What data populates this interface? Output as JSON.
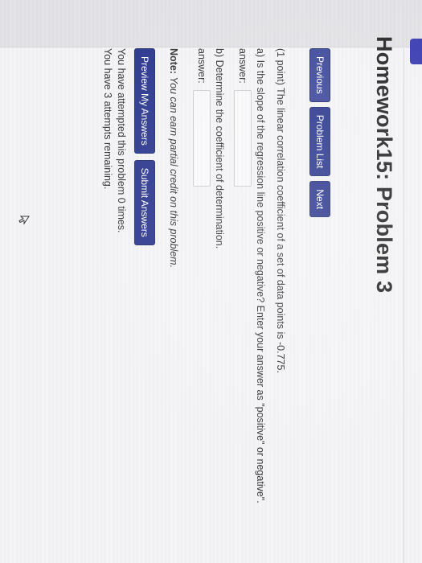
{
  "page": {
    "title": "Homework15: Problem 3"
  },
  "nav": {
    "previous_label": "Previous",
    "problem_list_label": "Problem List",
    "next_label": "Next"
  },
  "problem": {
    "intro": "(1 point) The linear correlation coefficient of a set of data points is -0.775.",
    "part_a": "a) Is the slope of the regression line positive or negative? Enter your answer as \"positive\" or negative\".",
    "answer_label_a": "answer:",
    "answer_value_a": "",
    "part_b": "b) Determine the coefficient of determination.",
    "answer_label_b": "answer:",
    "answer_value_b": ""
  },
  "note": {
    "label": "Note:",
    "text": "You can earn partial credit on this problem."
  },
  "actions": {
    "preview_label": "Preview My Answers",
    "submit_label": "Submit Answers"
  },
  "status": {
    "attempted": "You have attempted this problem 0 times.",
    "remaining": "You have 3 attempts remaining."
  },
  "colors": {
    "button_bg": "#2d3a8f",
    "button_text": "#ffffff",
    "page_bg": "#f4f3f6",
    "accent_tab": "#3d3fb4"
  },
  "icons": {
    "cursor": "mouse-pointer-icon"
  }
}
